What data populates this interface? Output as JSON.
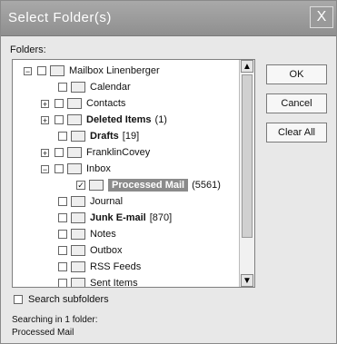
{
  "window": {
    "title": "Select Folder(s)",
    "close": "X"
  },
  "labels": {
    "folders": "Folders:"
  },
  "tree": {
    "root": "Mailbox Linenberger",
    "items": [
      {
        "label": "Calendar",
        "count": ""
      },
      {
        "label": "Contacts",
        "count": ""
      },
      {
        "label": "Deleted Items",
        "count": "(1)"
      },
      {
        "label": "Drafts",
        "count": "[19]"
      },
      {
        "label": "FranklinCovey",
        "count": ""
      },
      {
        "label": "Inbox",
        "count": ""
      },
      {
        "label": "Processed Mail",
        "count": "(5561)"
      },
      {
        "label": "Journal",
        "count": ""
      },
      {
        "label": "Junk E-mail",
        "count": "[870]"
      },
      {
        "label": "Notes",
        "count": ""
      },
      {
        "label": "Outbox",
        "count": ""
      },
      {
        "label": "RSS Feeds",
        "count": ""
      },
      {
        "label": "Sent Items",
        "count": ""
      }
    ]
  },
  "buttons": {
    "ok": "OK",
    "cancel": "Cancel",
    "clear_all": "Clear All"
  },
  "options": {
    "search_subfolders": "Search subfolders"
  },
  "status": {
    "line1": "Searching in 1 folder:",
    "line2": "Processed Mail"
  },
  "colors": {
    "title_bar": "#9a9a9a",
    "selected_bg": "#8b8b8b"
  }
}
